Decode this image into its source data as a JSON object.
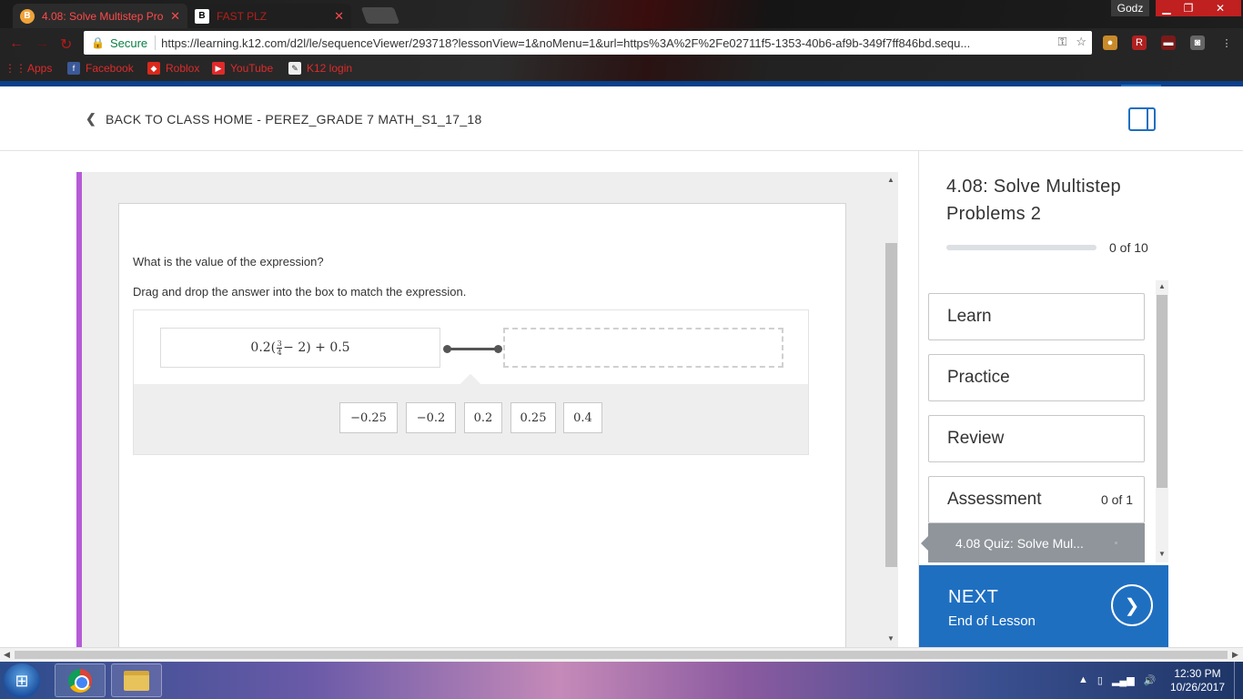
{
  "browser": {
    "tabs": [
      {
        "title": "4.08: Solve Multistep Pro",
        "favicon": "B",
        "active": true
      },
      {
        "title": "FAST PLZ",
        "favicon": "B",
        "active": false
      }
    ],
    "profile_name": "Godz",
    "secure_label": "Secure",
    "url": "https://learning.k12.com/d2l/le/sequenceViewer/293718?lessonView=1&noMenu=1&url=https%3A%2F%2Fe02711f5-1353-40b6-af9b-349f7ff846bd.sequ...",
    "bookmarks": [
      {
        "label": "Apps",
        "icon": "apps-grid-icon"
      },
      {
        "label": "Facebook",
        "icon": "facebook-icon"
      },
      {
        "label": "Roblox",
        "icon": "roblox-icon"
      },
      {
        "label": "YouTube",
        "icon": "youtube-icon"
      },
      {
        "label": "K12 login",
        "icon": "k12-icon"
      }
    ]
  },
  "page": {
    "back_link": "BACK TO CLASS HOME - PEREZ_GRADE 7 MATH_S1_17_18",
    "accent_color": "#b55bd8",
    "brand_color": "#1f6fc1"
  },
  "question": {
    "prompt": "What is the value of the expression?",
    "instruction": "Drag and drop the answer into the box to match the expression.",
    "expression": {
      "prefix": "0.2(",
      "frac_num": "3",
      "frac_den": "4",
      "suffix": " − 2) + 0.5"
    },
    "choices": [
      "−0.25",
      "−0.2",
      "0.2",
      "0.25",
      "0.4"
    ]
  },
  "sidebar": {
    "lesson_title": "4.08: Solve Multistep Problems 2",
    "progress_text": "0 of 10",
    "progress_fraction": 0,
    "nav": [
      {
        "label": "Learn"
      },
      {
        "label": "Practice"
      },
      {
        "label": "Review"
      },
      {
        "label": "Assessment",
        "count": "0 of 1"
      }
    ],
    "quiz_item": "4.08 Quiz: Solve Mul...",
    "next": {
      "label": "NEXT",
      "sub": "End of Lesson"
    }
  },
  "taskbar": {
    "time": "12:30 PM",
    "date": "10/26/2017"
  }
}
